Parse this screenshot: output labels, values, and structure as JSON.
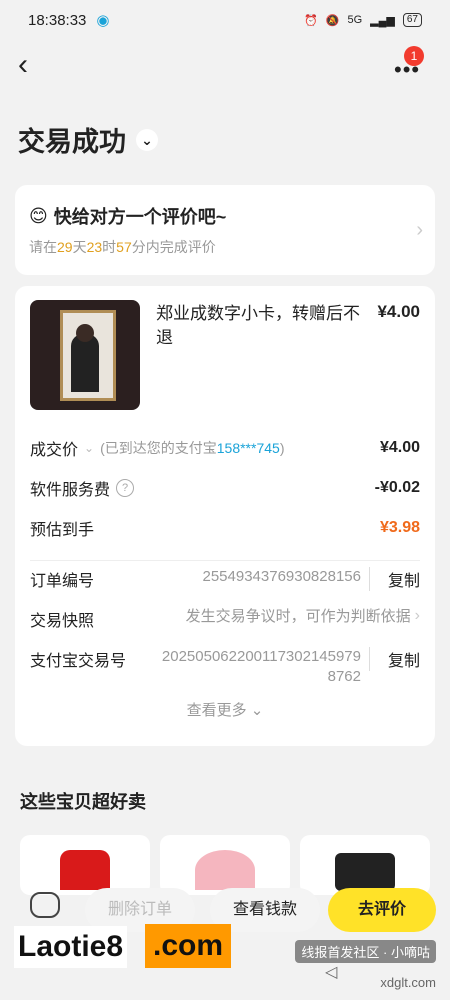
{
  "status": {
    "time": "18:38:33",
    "signal": "5G",
    "battery": "67"
  },
  "header": {
    "back_icon": "back-icon",
    "more_icon": "more-icon",
    "badge": "1"
  },
  "title": "交易成功",
  "rate_card": {
    "title": "快给对方一个评价吧~",
    "sub_prefix": "请在",
    "days": "29",
    "d_unit": "天",
    "hours": "23",
    "h_unit": "时",
    "minutes": "57",
    "m_unit": "分内完成评价"
  },
  "product": {
    "name": "郑业成数字小卡，转赠后不退",
    "price": "¥4.00"
  },
  "rows": {
    "deal_label": "成交价",
    "deal_note_prefix": "(已到达您的支付宝",
    "deal_note_acct": "158***745",
    "deal_note_suffix": ")",
    "deal_value": "¥4.00",
    "fee_label": "软件服务费",
    "fee_value": "-¥0.02",
    "est_label": "预估到手",
    "est_value": "¥3.98"
  },
  "info": {
    "order_label": "订单编号",
    "order_value": "2554934376930828156",
    "copy": "复制",
    "snapshot_label": "交易快照",
    "snapshot_value": "发生交易争议时，可作为判断依据",
    "alipay_label": "支付宝交易号",
    "alipay_value": "2025050622001173021459798762",
    "see_more": "查看更多"
  },
  "recommend_title": "这些宝贝超好卖",
  "bottom": {
    "delete": "删除订单",
    "view_money": "查看钱款",
    "review": "去评价"
  },
  "watermark": {
    "laotie": "Laotie8",
    "dotcom": ".com",
    "site": "线报首发社区",
    "xiaodi": "小嘀咕",
    "domain": "xdglt.com"
  }
}
